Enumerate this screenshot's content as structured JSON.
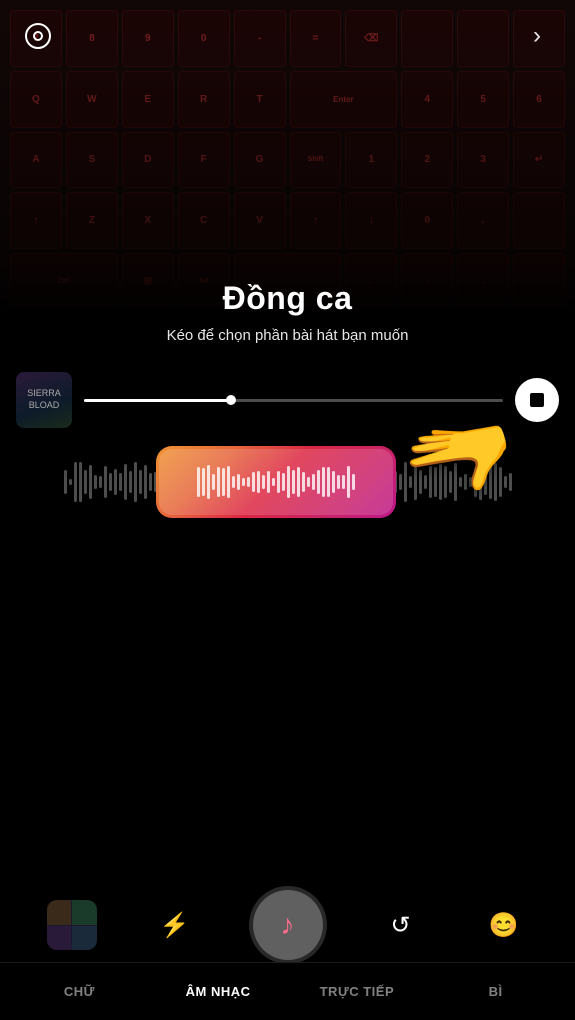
{
  "app": {
    "title": "Đồng ca",
    "subtitle": "Kéo để chọn phần bài hát bạn muốn"
  },
  "top_bar": {
    "settings_icon": "circle-settings",
    "next_icon": "chevron-right"
  },
  "track": {
    "progress_percent": 35,
    "stop_label": "stop"
  },
  "toolbar": {
    "gallery_icon": "gallery",
    "effects_icon": "lightning",
    "music_icon": "music-note",
    "flip_icon": "rotate",
    "filters_icon": "smiley-star"
  },
  "bottom_nav": {
    "items": [
      {
        "id": "chu",
        "label": "CHỮ",
        "active": false
      },
      {
        "id": "am-nhac",
        "label": "ÂM NHẠC",
        "active": true
      },
      {
        "id": "truc-tiep",
        "label": "TRỰC TIẾP",
        "active": false
      },
      {
        "id": "bi",
        "label": "BÌ",
        "active": false
      }
    ]
  },
  "waveform": {
    "bars_count": 80,
    "selected_bars": 28
  }
}
